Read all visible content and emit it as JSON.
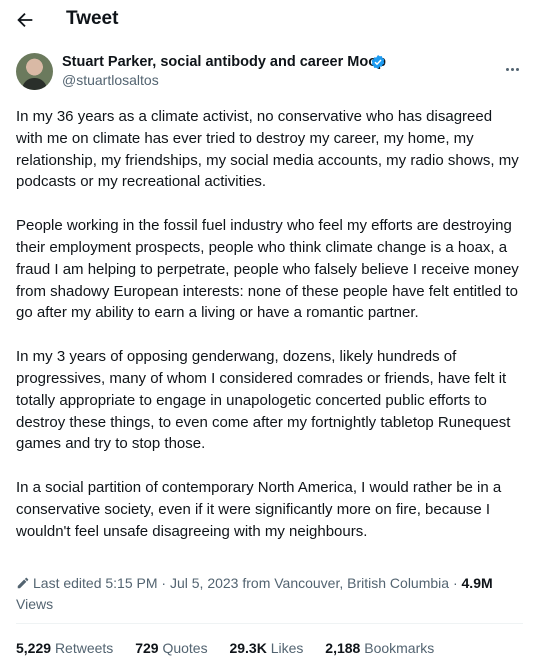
{
  "header": {
    "title": "Tweet",
    "back_icon": "arrow-left-icon"
  },
  "author": {
    "display_name": "Stuart Parker, social antibody and career Moop",
    "handle": "@stuartlosaltos",
    "verified": true,
    "verified_color": "#1d9bf0"
  },
  "tweet": {
    "paragraphs": [
      "In my 36 years as a climate activist, no conservative who has disagreed with me on climate has ever tried to destroy my career, my home, my relationship, my friendships, my social media accounts, my radio shows, my podcasts or my recreational activities.",
      "People working in the fossil fuel industry who feel my efforts are destroying their employment prospects, people who think climate change is a hoax, a fraud I am helping to perpetrate, people who falsely believe I receive money from shadowy European interests: none of these people have felt entitled to go after my ability to earn a living or have a romantic partner.",
      "In my 3 years of opposing genderwang, dozens, likely hundreds of progressives, many of whom I considered comrades or friends, have felt it totally appropriate to engage in unapologetic concerted public efforts to destroy these things, to even come after my fortnightly tabletop Runequest games and try to stop those.",
      "In a social partition of contemporary North America, I would rather be in a conservative society, even if it were significantly more on fire, because I wouldn't feel unsafe disagreeing with my neighbours."
    ],
    "edited_text": "Last edited 5:15 PM · Jul 5, 2023 from Vancouver, British Columbia",
    "separator": "·",
    "views_count": "4.9M",
    "views_label": "Views"
  },
  "stats": {
    "retweets_count": "5,229",
    "retweets_label": "Retweets",
    "quotes_count": "729",
    "quotes_label": "Quotes",
    "likes_count": "29.3K",
    "likes_label": "Likes",
    "bookmarks_count": "2,188",
    "bookmarks_label": "Bookmarks"
  }
}
